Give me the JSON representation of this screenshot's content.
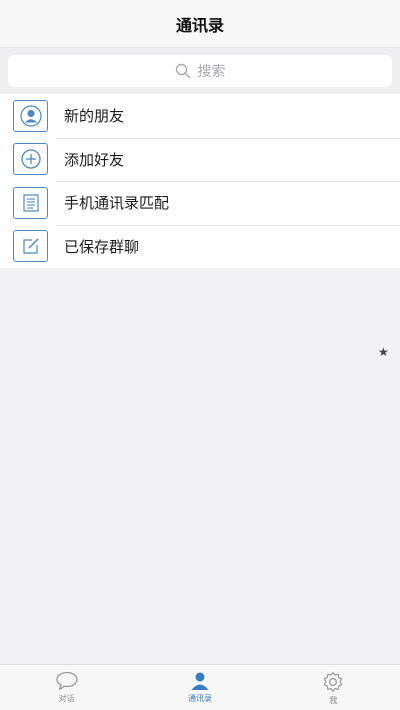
{
  "header": {
    "title": "通讯录"
  },
  "search": {
    "placeholder": "搜索"
  },
  "menu": {
    "items": [
      {
        "label": "新的朋友",
        "icon": "person-icon"
      },
      {
        "label": "添加好友",
        "icon": "plus-circle-icon"
      },
      {
        "label": "手机通讯录匹配",
        "icon": "address-book-icon"
      },
      {
        "label": "已保存群聊",
        "icon": "edit-icon"
      }
    ]
  },
  "floating": {
    "star": "★"
  },
  "tabbar": {
    "tabs": [
      {
        "label": "对话",
        "icon": "chat-bubble-icon",
        "active": false
      },
      {
        "label": "通讯录",
        "icon": "person-icon",
        "active": true
      },
      {
        "label": "我",
        "icon": "gear-icon",
        "active": false
      }
    ]
  },
  "colors": {
    "accent": "#3a7cc0",
    "icon_border": "#4a88c8",
    "background": "#f2f2f4"
  }
}
